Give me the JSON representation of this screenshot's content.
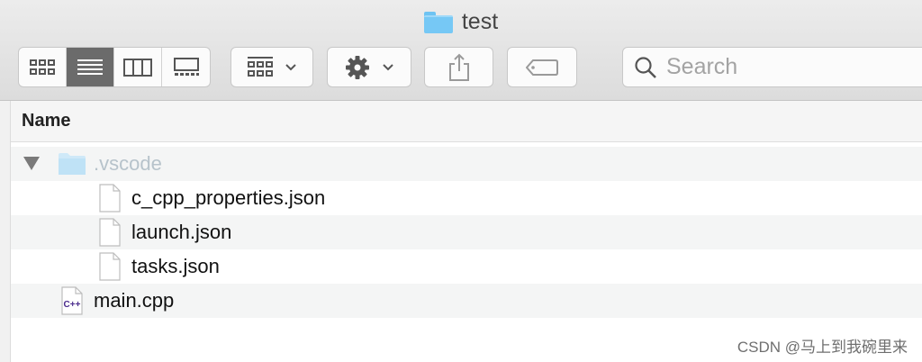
{
  "window": {
    "title": "test"
  },
  "toolbar": {
    "view_buttons": [
      {
        "name": "icon-view",
        "active": false
      },
      {
        "name": "list-view",
        "active": true
      },
      {
        "name": "column-view",
        "active": false
      },
      {
        "name": "gallery-view",
        "active": false
      }
    ],
    "group_button": {
      "icon": "group-by-icon"
    },
    "action_button": {
      "icon": "gear-icon"
    },
    "share_button": {
      "icon": "share-icon"
    },
    "tag_button": {
      "icon": "tag-icon"
    }
  },
  "search": {
    "placeholder": "Search"
  },
  "columns": {
    "name_header": "Name"
  },
  "files": [
    {
      "name": ".vscode",
      "type": "folder",
      "expanded": true,
      "dimmed": true
    },
    {
      "name": "c_cpp_properties.json",
      "type": "file"
    },
    {
      "name": "launch.json",
      "type": "file"
    },
    {
      "name": "tasks.json",
      "type": "file"
    },
    {
      "name": "main.cpp",
      "type": "cpp-file",
      "icon_text": "C++"
    }
  ],
  "watermark": "CSDN @马上到我碗里来",
  "colors": {
    "folder_blue": "#76c8f5",
    "active_view": "#6b6b6b",
    "cpp_purple": "#4a2b8c"
  }
}
